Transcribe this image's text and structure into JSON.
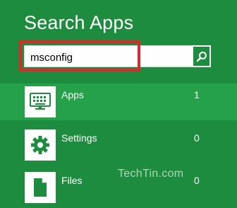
{
  "header": {
    "title": "Search Apps"
  },
  "search": {
    "value": "msconfig"
  },
  "results": [
    {
      "label": "Apps",
      "count": "1",
      "icon": "keyboard-monitor-icon",
      "selected": true
    },
    {
      "label": "Settings",
      "count": "0",
      "icon": "gear-icon",
      "selected": false
    },
    {
      "label": "Files",
      "count": "0",
      "icon": "document-icon",
      "selected": false
    }
  ],
  "watermark": "TechTin.com",
  "colors": {
    "background": "#1e8c3f",
    "selected_row": "#25a149",
    "highlight": "#e3262b"
  }
}
